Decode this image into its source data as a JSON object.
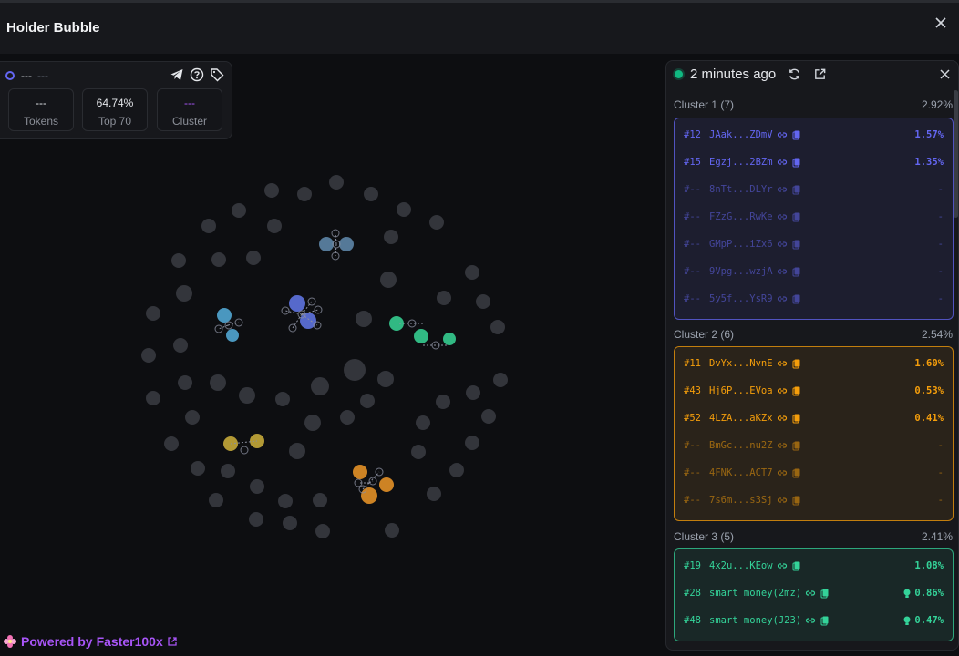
{
  "header": {
    "title": "Holder Bubble"
  },
  "stats": {
    "token_symbol": "---",
    "token_sub": "---",
    "boxes": [
      {
        "value": "---",
        "label": "Tokens"
      },
      {
        "value": "64.74%",
        "label": "Top 70"
      },
      {
        "value": "---",
        "label": "Cluster"
      }
    ]
  },
  "footer": {
    "prefix": "Powered by ",
    "brand": "Faster100x"
  },
  "panel": {
    "updated": "2 minutes ago",
    "clusters": [
      {
        "title": "Cluster 1 (7)",
        "share": "2.92%",
        "color": "#6366f1",
        "rows": [
          {
            "rank": "#12",
            "addr": "JAak...ZDmV",
            "share": "1.57%"
          },
          {
            "rank": "#15",
            "addr": "Egzj...2BZm",
            "share": "1.35%"
          },
          {
            "rank": "#--",
            "addr": "8nTt...DLYr",
            "share": "-"
          },
          {
            "rank": "#--",
            "addr": "FZzG...RwKe",
            "share": "-"
          },
          {
            "rank": "#--",
            "addr": "GMpP...iZx6",
            "share": "-"
          },
          {
            "rank": "#--",
            "addr": "9Vpg...wzjA",
            "share": "-"
          },
          {
            "rank": "#--",
            "addr": "5y5f...YsR9",
            "share": "-"
          }
        ]
      },
      {
        "title": "Cluster 2 (6)",
        "share": "2.54%",
        "color": "#f59e0b",
        "rows": [
          {
            "rank": "#11",
            "addr": "DvYx...NvnE",
            "share": "1.60%"
          },
          {
            "rank": "#43",
            "addr": "Hj6P...EVoa",
            "share": "0.53%"
          },
          {
            "rank": "#52",
            "addr": "4LZA...aKZx",
            "share": "0.41%"
          },
          {
            "rank": "#--",
            "addr": "BmGc...nu2Z",
            "share": "-"
          },
          {
            "rank": "#--",
            "addr": "4FNK...ACT7",
            "share": "-"
          },
          {
            "rank": "#--",
            "addr": "7s6m...s3Sj",
            "share": "-"
          }
        ]
      },
      {
        "title": "Cluster 3 (5)",
        "share": "2.41%",
        "color": "#34d399",
        "rows": [
          {
            "rank": "#19",
            "addr": "4x2u...KEow",
            "share": "1.08%"
          },
          {
            "rank": "#28",
            "addr": "smart money(2mz)",
            "share": "0.86%",
            "smart": true
          },
          {
            "rank": "#48",
            "addr": "smart money(J23)",
            "share": "0.47%",
            "smart": true
          }
        ]
      }
    ]
  },
  "bubbles": {
    "gray": "#33353b",
    "cluster_colors": [
      "#5b6fd6",
      "#d88a26",
      "#34c38a",
      "#c4a93a",
      "#4e9fc9",
      "#5a7fa0"
    ]
  }
}
